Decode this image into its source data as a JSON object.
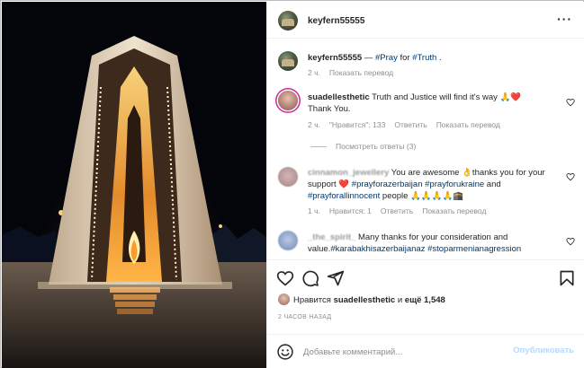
{
  "post": {
    "author": "keyfern55555",
    "caption_sep": " — ",
    "caption_tags": [
      "#Pray",
      "#Truth"
    ],
    "caption_mid": " for ",
    "caption_end": " .",
    "time": "2 ч.",
    "translate": "Показать перевод"
  },
  "comments": [
    {
      "user": "suadellesthetic",
      "text": " Truth and Justice will find it's way 🙏❤️",
      "text2": "Thank You.",
      "time": "2 ч.",
      "likes": "\"Нравится\": 133",
      "reply": "Ответить",
      "translate": "Показать перевод",
      "view_replies": "Посмотреть ответы (3)"
    },
    {
      "user": "cinnamon_jewellery",
      "text_start": " You are awesome 👌thanks you for your support ❤️ ",
      "tags": [
        "#prayforazerbaijan",
        "#prayforukraine",
        "#prayforallinnocent"
      ],
      "and": " and ",
      "text_end": " people 🙏🙏🙏🙏🕋",
      "time": "1 ч.",
      "likes": "Нравится: 1",
      "reply": "Ответить",
      "translate": "Показать перевод"
    },
    {
      "user": "_the_spirit_",
      "text_start": " Many thanks for your consideration and value.",
      "tags": [
        "#karabakhisazerbaijanaz",
        "#stoparmenianagression"
      ]
    }
  ],
  "likes": {
    "prefix": "Нравится ",
    "user": "suadellesthetic",
    "mid": " и ",
    "rest": "ещё 1,548"
  },
  "time_ago": "2 ЧАСОВ НАЗАД",
  "add_comment": {
    "placeholder": "Добавьте комментарий...",
    "post_label": "Опубликовать"
  },
  "colors": {
    "link": "#00376b",
    "meta": "#8e8e8e",
    "post_disabled": "#b3dbff",
    "heart": "#ed4956"
  }
}
